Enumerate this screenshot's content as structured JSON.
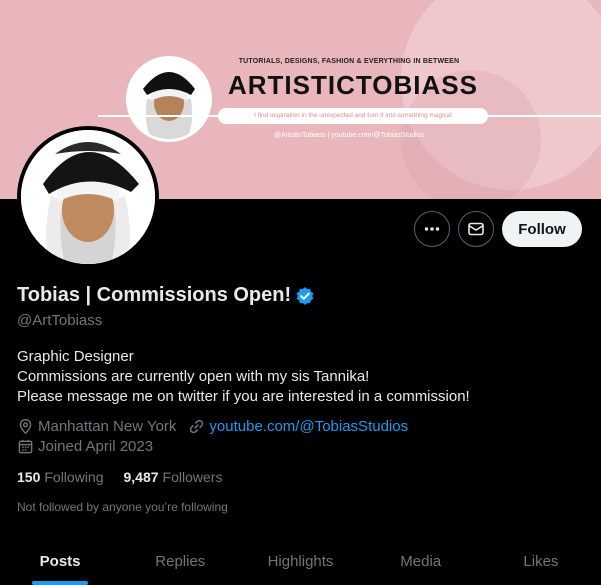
{
  "banner": {
    "tagline": "TUTORIALS, DESIGNS, FASHION & EVERYTHING IN BETWEEN",
    "name": "ARTISTICTOBIASS",
    "slogan": "I find inspiration in the unexpected and turn it into something magical",
    "links": "@ArtisticTobiass  |  youtube.com/@TobiasStudios",
    "color": "#e9b6bb"
  },
  "actions": {
    "more_icon": "more-icon",
    "message_icon": "envelope-icon",
    "follow_label": "Follow"
  },
  "profile": {
    "display_name": "Tobias | Commissions Open!",
    "verified_icon": "verified-badge-icon",
    "handle": "@ArtTobiass",
    "bio": [
      "Graphic Designer",
      "Commissions are currently open with my sis Tannika!",
      "Please message me on twitter if you are interested in a commission!"
    ],
    "location": "Manhattan New York",
    "website": "youtube.com/@TobiasStudios",
    "joined": "Joined April 2023",
    "following_count": "150",
    "following_label": "Following",
    "followers_count": "9,487",
    "followers_label": "Followers",
    "not_followed_text": "Not followed by anyone you’re following"
  },
  "tabs": [
    {
      "label": "Posts",
      "active": true
    },
    {
      "label": "Replies",
      "active": false
    },
    {
      "label": "Highlights",
      "active": false
    },
    {
      "label": "Media",
      "active": false
    },
    {
      "label": "Likes",
      "active": false
    }
  ],
  "colors": {
    "accent": "#1d9bf0",
    "text": "#e7e9ea",
    "muted": "#71767b",
    "background": "#000000"
  }
}
